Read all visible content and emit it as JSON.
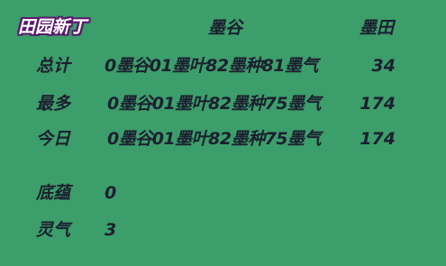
{
  "title": "田园新丁",
  "headers": {
    "col1": "墨谷",
    "col2": "墨田"
  },
  "rows": [
    {
      "label": "总计",
      "value": "0墨谷01墨叶82墨种81墨气",
      "num": "34"
    },
    {
      "label": "最多",
      "value": "0墨谷01墨叶82墨种75墨气",
      "num": "174"
    },
    {
      "label": "今日",
      "value": "0墨谷01墨叶82墨种75墨气",
      "num": "174"
    }
  ],
  "stats": [
    {
      "label": "底蕴",
      "value": "0"
    },
    {
      "label": "灵气",
      "value": "3"
    }
  ],
  "colors": {
    "background": "#3c9e6a",
    "text": "#1c2030",
    "title_fill": "#ffffff",
    "title_outline": "#5a1a6e"
  }
}
